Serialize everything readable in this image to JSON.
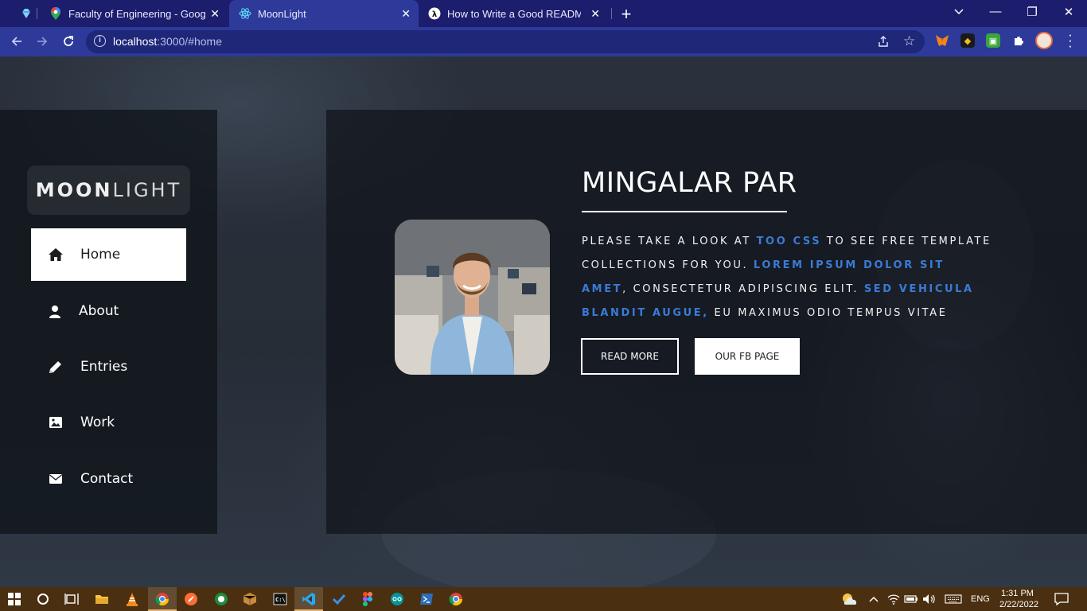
{
  "browser": {
    "tabs": [
      {
        "title": "Faculty of Engineering - Google I",
        "favicon": "maps-pin-icon"
      },
      {
        "title": "MoonLight",
        "favicon": "react-icon",
        "active": true
      },
      {
        "title": "How to Write a Good README Fi",
        "favicon": "lambda-icon"
      }
    ],
    "url_host": "localhost",
    "url_rest": ":3000/#home"
  },
  "site": {
    "logo_bold": "MOON",
    "logo_light": "LIGHT",
    "nav": [
      {
        "label": "Home",
        "icon": "home-icon",
        "active": true
      },
      {
        "label": "About",
        "icon": "user-icon"
      },
      {
        "label": "Entries",
        "icon": "pencil-icon"
      },
      {
        "label": "Work",
        "icon": "image-icon"
      },
      {
        "label": "Contact",
        "icon": "envelope-icon"
      }
    ],
    "hero": {
      "heading": "MINGALAR PAR",
      "text_1": "PLEASE TAKE A LOOK AT ",
      "link_1": "TOO CSS",
      "text_2": " TO SEE FREE TEMPLATE COLLECTIONS FOR YOU. ",
      "link_2": "LOREM IPSUM DOLOR SIT AMET",
      "text_3": ", CONSECTETUR ADIPISCING ELIT. ",
      "link_3": "SED VEHICULA BLANDIT AUGUE,",
      "text_4": " EU MAXIMUS ODIO TEMPUS VITAE",
      "btn_read_more": "READ MORE",
      "btn_fb": "OUR FB PAGE"
    }
  },
  "taskbar": {
    "lang": "ENG",
    "time": "1:31 PM",
    "date": "2/22/2022"
  },
  "colors": {
    "accent_link": "#3a7bd5",
    "tab_strip": "#1d1d6e",
    "toolbar": "#2d3a9a",
    "taskbar": "#4a2f10"
  }
}
